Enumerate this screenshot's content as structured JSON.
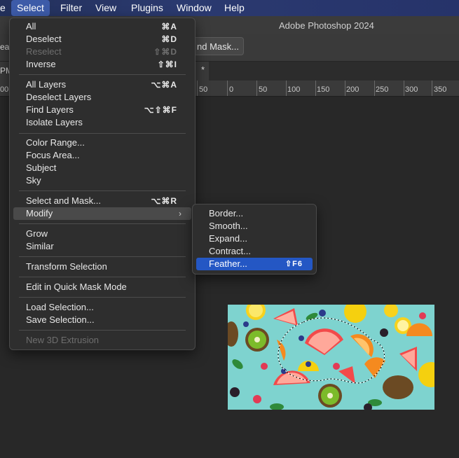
{
  "menubar": {
    "items": [
      "e",
      "Select",
      "Filter",
      "View",
      "Plugins",
      "Window",
      "Help"
    ]
  },
  "titlebar": {
    "title": "Adobe Photoshop 2024"
  },
  "optionsbar": {
    "left_fragment": "ea",
    "select_mask_button": "nd Mask..."
  },
  "tabs": {
    "left": "PM",
    "right": "*"
  },
  "ruler": {
    "labels": [
      "00",
      "50",
      "0",
      "50",
      "100",
      "150",
      "200",
      "250",
      "300",
      "350"
    ]
  },
  "select_menu": {
    "items": [
      {
        "label": "All",
        "shortcut": "⌘A"
      },
      {
        "label": "Deselect",
        "shortcut": "⌘D"
      },
      {
        "label": "Reselect",
        "shortcut": "⇧⌘D",
        "disabled": true
      },
      {
        "label": "Inverse",
        "shortcut": "⇧⌘I"
      },
      {
        "label": "All Layers",
        "shortcut": "⌥⌘A"
      },
      {
        "label": "Deselect Layers",
        "shortcut": ""
      },
      {
        "label": "Find Layers",
        "shortcut": "⌥⇧⌘F"
      },
      {
        "label": "Isolate Layers",
        "shortcut": ""
      },
      {
        "label": "Color Range...",
        "shortcut": ""
      },
      {
        "label": "Focus Area...",
        "shortcut": ""
      },
      {
        "label": "Subject",
        "shortcut": ""
      },
      {
        "label": "Sky",
        "shortcut": ""
      },
      {
        "label": "Select and Mask...",
        "shortcut": "⌥⌘R"
      },
      {
        "label": "Modify",
        "shortcut": "",
        "submenu": "›"
      },
      {
        "label": "Grow",
        "shortcut": ""
      },
      {
        "label": "Similar",
        "shortcut": ""
      },
      {
        "label": "Transform Selection",
        "shortcut": ""
      },
      {
        "label": "Edit in Quick Mask Mode",
        "shortcut": ""
      },
      {
        "label": "Load Selection...",
        "shortcut": ""
      },
      {
        "label": "Save Selection...",
        "shortcut": ""
      },
      {
        "label": "New 3D Extrusion",
        "shortcut": "",
        "disabled": true
      }
    ]
  },
  "modify_menu": {
    "items": [
      {
        "label": "Border...",
        "shortcut": ""
      },
      {
        "label": "Smooth...",
        "shortcut": ""
      },
      {
        "label": "Expand...",
        "shortcut": ""
      },
      {
        "label": "Contract...",
        "shortcut": ""
      },
      {
        "label": "Feather...",
        "shortcut": "⇧F6"
      }
    ]
  },
  "colors": {
    "menubar_active": "#3d5ba8",
    "highlight": "#2457c4",
    "photo_bg": "#7ed3cf"
  }
}
